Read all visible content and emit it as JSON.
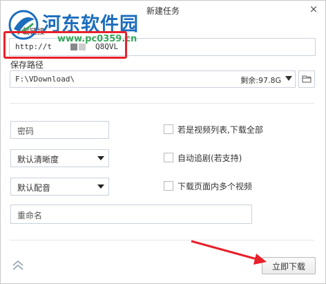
{
  "dialog": {
    "title": "新建任务",
    "close_glyph": "×"
  },
  "watermark": {
    "site_name": "河东软件园",
    "site_url": "www.pc0359.cn"
  },
  "url": {
    "label": "下载链接",
    "value_prefix": "http://t",
    "value_suffix": "Q8QVL"
  },
  "save_path": {
    "label": "保存路径",
    "value": "F:\\VDownload\\",
    "free_space": "剩余:97.8G",
    "folder_icon": "folder-icon"
  },
  "options": {
    "password_placeholder": "密码",
    "quality_selected": "默认清晰度",
    "dubbing_selected": "默认配音",
    "rename_placeholder": "重命名",
    "checkboxes": [
      {
        "label": "若是视频列表,下载全部",
        "checked": false
      },
      {
        "label": "自动追剧(若支持)",
        "checked": false
      },
      {
        "label": "下载页面内多个视频",
        "checked": false
      }
    ]
  },
  "footer": {
    "collapse_icon": "double-chevron-up-icon",
    "start_label": "立即下载"
  },
  "annotations": {
    "highlight_color": "#e8202a"
  }
}
